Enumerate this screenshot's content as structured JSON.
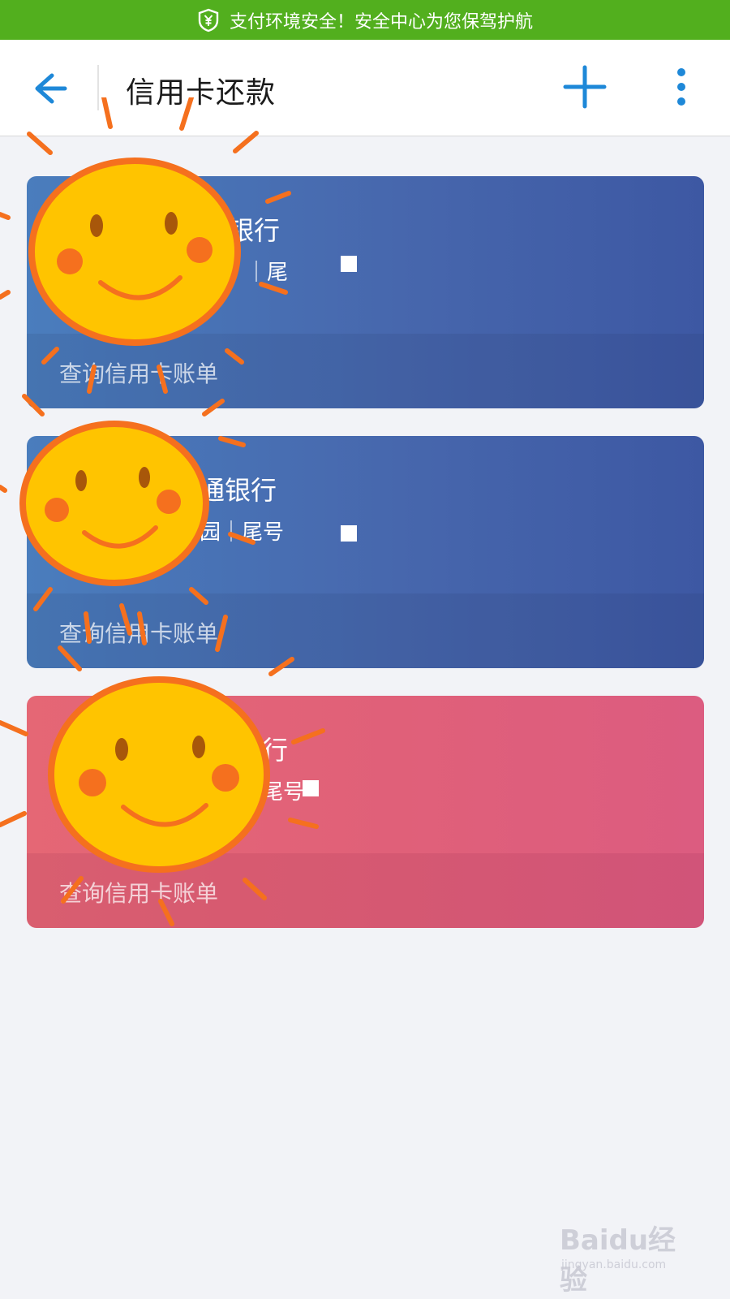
{
  "banner": {
    "text": "支付环境安全！安全中心为您保驾护航",
    "icon": "shield-yen-icon",
    "color": "#52af1e"
  },
  "header": {
    "title": "信用卡还款",
    "back_icon": "arrow-left-icon",
    "add_icon": "plus-icon",
    "more_icon": "more-vertical-icon",
    "accent": "#1e88d8"
  },
  "cards": [
    {
      "bank_name": "银行",
      "meta": "｜尾",
      "bill_link": "查询信用卡账单",
      "color": "#4767ad"
    },
    {
      "bank_name": "通银行",
      "meta": "园｜尾号",
      "bill_link": "查询信用卡账单",
      "color": "#4767ad"
    },
    {
      "bank_name": "行",
      "meta": "尾号",
      "bill_link": "查询信用卡账单",
      "color": "#e06079"
    }
  ],
  "overlay": {
    "doodle": "smiley-sun-icon",
    "sun_color": "#ffc400",
    "ray_color": "#f5701e"
  },
  "watermark": {
    "logo": "Baidu经验",
    "url": "jingyan.baidu.com"
  }
}
